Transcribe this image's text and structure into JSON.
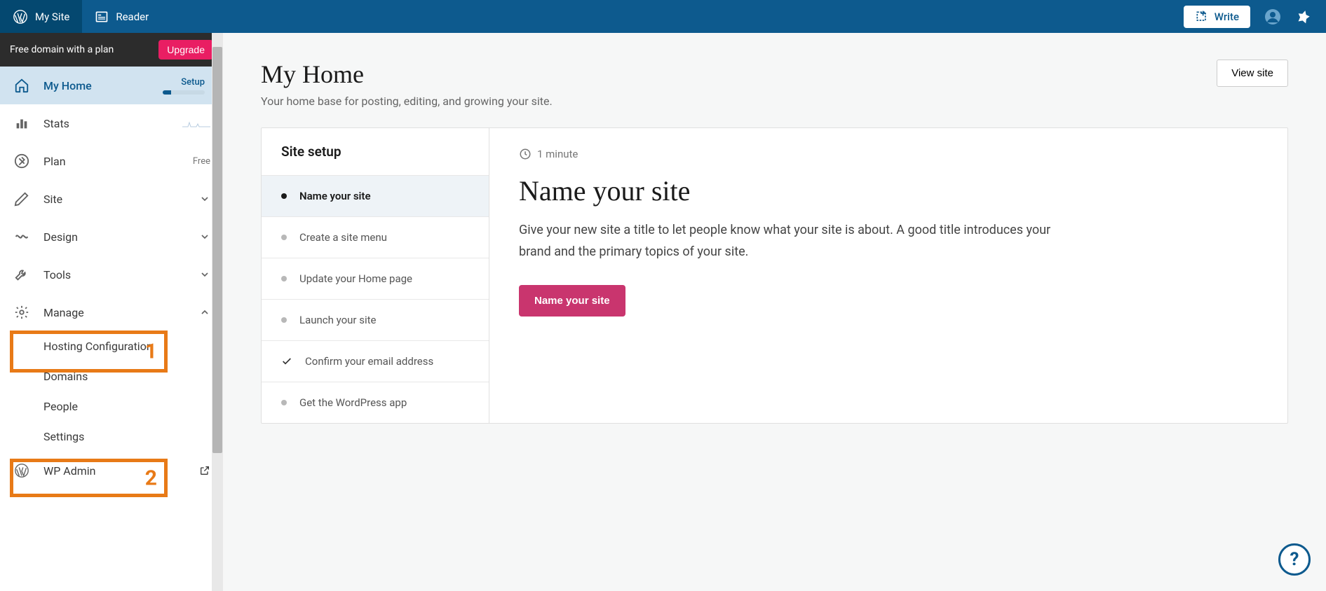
{
  "topbar": {
    "my_site": "My Site",
    "reader": "Reader",
    "write": "Write"
  },
  "promo": {
    "text": "Free domain with a plan",
    "upgrade": "Upgrade"
  },
  "sidebar": {
    "my_home": "My Home",
    "setup_label": "Setup",
    "stats": "Stats",
    "plan": "Plan",
    "plan_tag": "Free",
    "site": "Site",
    "design": "Design",
    "tools": "Tools",
    "manage": "Manage",
    "manage_sub": {
      "hosting": "Hosting Configuration",
      "domains": "Domains",
      "people": "People",
      "settings": "Settings"
    },
    "wp_admin": "WP Admin"
  },
  "annotations": {
    "one": "1",
    "two": "2"
  },
  "page": {
    "title": "My Home",
    "subtitle": "Your home base for posting, editing, and growing your site.",
    "view_site": "View site"
  },
  "setup": {
    "header": "Site setup",
    "items": [
      {
        "label": "Name your site"
      },
      {
        "label": "Create a site menu"
      },
      {
        "label": "Update your Home page"
      },
      {
        "label": "Launch your site"
      },
      {
        "label": "Confirm your email address"
      },
      {
        "label": "Get the WordPress app"
      }
    ]
  },
  "detail": {
    "time": "1 minute",
    "title": "Name your site",
    "desc": "Give your new site a title to let people know what your site is about. A good title introduces your brand and the primary topics of your site.",
    "cta": "Name your site"
  }
}
